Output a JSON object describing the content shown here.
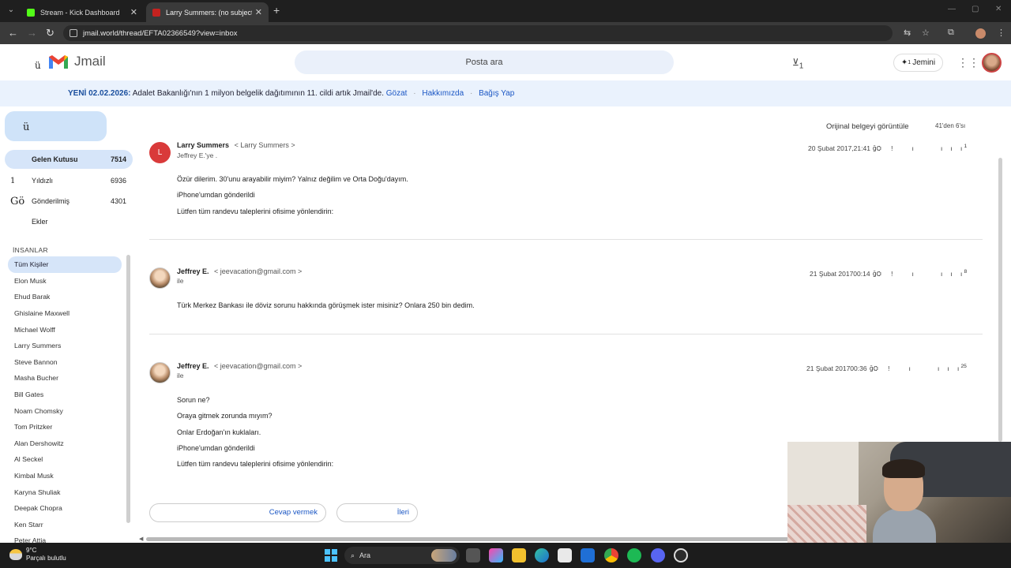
{
  "browser": {
    "tabs": [
      {
        "title": "Stream - Kick Dashboard",
        "favicon_color": "#53fc18"
      },
      {
        "title": "Larry Summers: (no subject) —",
        "favicon_color": "#c5221f"
      }
    ],
    "url": "jmail.world/thread/EFTA02366549?view=inbox"
  },
  "app": {
    "name": "Jmail",
    "menu_glyph": "ü",
    "search_placeholder": "Posta ara",
    "header_badge": "1",
    "jemini_label": "Jemini",
    "jemini_badge": "1"
  },
  "banner": {
    "new_label": "YENİ 02.02.2026:",
    "text": "Adalet Bakanlığı'nın 1 milyon belgelik dağıtımının 11. cildi artık Jmail'de.",
    "link1": "Gözat",
    "link2": "Hakkımızda",
    "link3": "Bağış Yap",
    "separator": "·"
  },
  "sidebar": {
    "compose_glyph": "ü",
    "folders": [
      {
        "label": "Gelen Kutusu",
        "count": "7514",
        "lead": ""
      },
      {
        "label": "Yıldızlı",
        "count": "6936",
        "lead": "1"
      },
      {
        "label": "Gönderilmiş",
        "count": "4301",
        "lead": "Gö"
      },
      {
        "label": "Ekler",
        "count": "",
        "lead": ""
      }
    ],
    "people_header": "İNSANLAR",
    "people": [
      "Tüm Kişiler",
      "Elon Musk",
      "Ehud Barak",
      "Ghislaine Maxwell",
      "Michael Wolff",
      "Larry Summers",
      "Steve Bannon",
      "Masha Bucher",
      "Bill Gates",
      "Noam Chomsky",
      "Tom Pritzker",
      "Alan Dershowitz",
      "Al Seckel",
      "Kimbal Musk",
      "Karyna Shuliak",
      "Deepak Chopra",
      "Ken Starr",
      "Peter Attia"
    ]
  },
  "thread": {
    "original_label": "Orijinal belgeyi görüntüle",
    "pager": "41'den 6'sı",
    "messages": [
      {
        "avatar_letter": "L",
        "sender": "Larry Summers",
        "address": "< Larry Summers >",
        "recipient": "Jeffrey E.'ye .",
        "date": "20 Şubat 2017,21:41",
        "corner": "1",
        "lines": [
          "Özür dilerim. 30'unu arayabilir miyim? Yalnız değilim ve Orta Doğu'dayım.",
          "iPhone'umdan gönderildi",
          "Lütfen tüm randevu taleplerini ofisime yönlendirin:"
        ]
      },
      {
        "avatar_letter": "",
        "sender": "Jeffrey E.",
        "address": "< jeevacation@gmail.com >",
        "recipient": "ile",
        "date": "21 Şubat 201700:14",
        "corner": "8",
        "lines": [
          "Türk Merkez Bankası ile döviz sorunu hakkında görüşmek ister misiniz? Onlara 250 bin dedim."
        ]
      },
      {
        "avatar_letter": "",
        "sender": "Jeffrey E.",
        "address": "< jeevacation@gmail.com >",
        "recipient": "ile",
        "date": "21 Şubat 201700:36",
        "corner": "25",
        "lines": [
          "Sorun ne?",
          "Oraya gitmek zorunda mıyım?",
          "Onlar Erdoğan'ın kuklaları.",
          "iPhone'umdan gönderildi",
          "Lütfen tüm randevu taleplerini ofisime yönlendirin:"
        ]
      }
    ],
    "reply_label": "Cevap vermek",
    "forward_label": "İleri"
  },
  "taskbar": {
    "temp": "9°C",
    "weather": "Parçalı bulutlu",
    "search": "Ara"
  }
}
